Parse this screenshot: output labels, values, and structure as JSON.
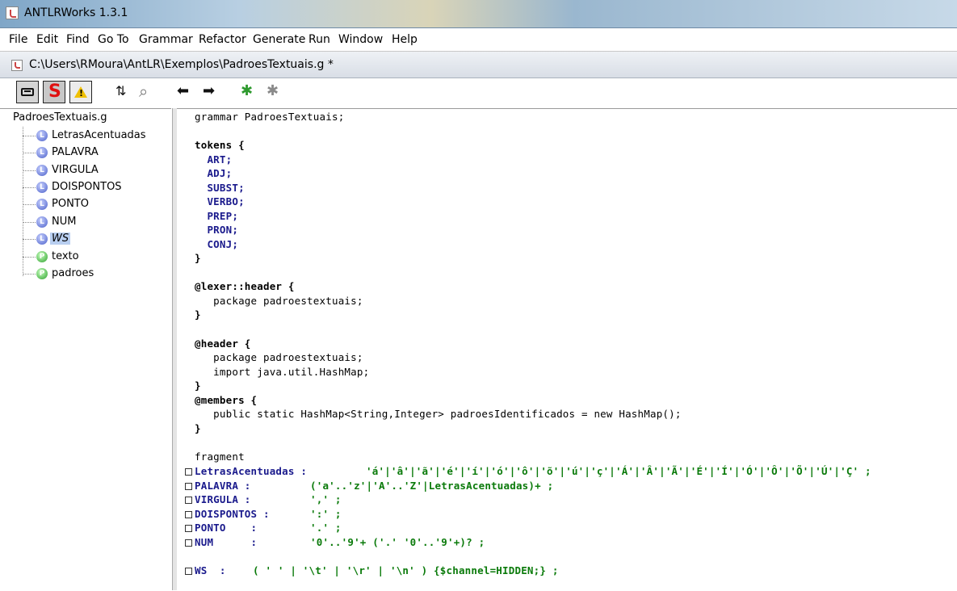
{
  "window": {
    "title": "ANTLRWorks 1.3.1"
  },
  "menu": [
    "File",
    "Edit",
    "Find",
    "Go To",
    "Grammar",
    "Refactor",
    "Generate",
    "Run",
    "Window",
    "Help"
  ],
  "document": {
    "path": "C:\\Users\\RMoura\\AntLR\\Exemplos\\PadroesTextuais.g *"
  },
  "toolbar": {
    "buttons": [
      {
        "name": "grammar-view-icon"
      },
      {
        "name": "syntax-s-icon",
        "label": "S"
      },
      {
        "name": "warning-icon",
        "label": "!"
      },
      {
        "name": "sort-icon",
        "label": "⇅"
      },
      {
        "name": "find-icon",
        "label": "⌕"
      },
      {
        "name": "back-arrow-icon",
        "label": "⬅"
      },
      {
        "name": "forward-arrow-icon",
        "label": "➡"
      },
      {
        "name": "debug-bug-icon",
        "label": "✱"
      },
      {
        "name": "debug-disabled-icon",
        "label": "✱"
      }
    ]
  },
  "tree": {
    "root": "PadroesTextuais.g",
    "items": [
      {
        "type": "L",
        "label": "LetrasAcentuadas"
      },
      {
        "type": "L",
        "label": "PALAVRA"
      },
      {
        "type": "L",
        "label": "VIRGULA"
      },
      {
        "type": "L",
        "label": "DOISPONTOS"
      },
      {
        "type": "L",
        "label": "PONTO"
      },
      {
        "type": "L",
        "label": "NUM"
      },
      {
        "type": "L",
        "label": "WS",
        "selected": true
      },
      {
        "type": "P",
        "label": "texto"
      },
      {
        "type": "P",
        "label": "padroes"
      }
    ]
  },
  "code": {
    "l1": "grammar PadroesTextuais;",
    "l3": "tokens {",
    "l4": "  ART;",
    "l5": "  ADJ;",
    "l6": "  SUBST;",
    "l7": "  VERBO;",
    "l8": "  PREP;",
    "l9": "  PRON;",
    "l10": "  CONJ;",
    "l11": "}",
    "l13": "@lexer::header {",
    "l14": "   package padroestextuais;",
    "l15": "}",
    "l17": "@header {",
    "l18": "   package padroestextuais;",
    "l19": "   import java.util.HashMap;",
    "l20": "}",
    "l21": "@members {",
    "l22": "   public static HashMap<String,Integer> padroesIdentificados = new HashMap();",
    "l23": "}",
    "l25": "fragment",
    "l26a": "LetrasAcentuadas :",
    "l26b": "'á'|'â'|'ã'|'é'|'í'|'ó'|'ô'|'õ'|'ú'|'ç'|'Á'|'Â'|'Ã'|'É'|'Í'|'Ó'|'Ô'|'Õ'|'Ú'|'Ç' ;",
    "l27a": "PALAVRA :",
    "l27b": "('a'..'z'|'A'..'Z'|LetrasAcentuadas)+ ;",
    "l28a": "VIRGULA :",
    "l28b": "',' ;",
    "l29a": "DOISPONTOS :",
    "l29b": "':' ;",
    "l30a": "PONTO    :",
    "l30b": "'.' ;",
    "l31a": "NUM      :",
    "l31b": "'0'..'9'+ ('.' '0'..'9'+)? ;",
    "l33a": "WS  :",
    "l33b": "( ' ' | '\\t' | '\\r' | '\\n' ) {$channel=HIDDEN;} ;"
  },
  "colors": {
    "token": "#1a1a8c",
    "string": "#0a7a0a",
    "selection": "#b8cef0",
    "warning": "#f0c000",
    "s_button": "#e01010"
  }
}
